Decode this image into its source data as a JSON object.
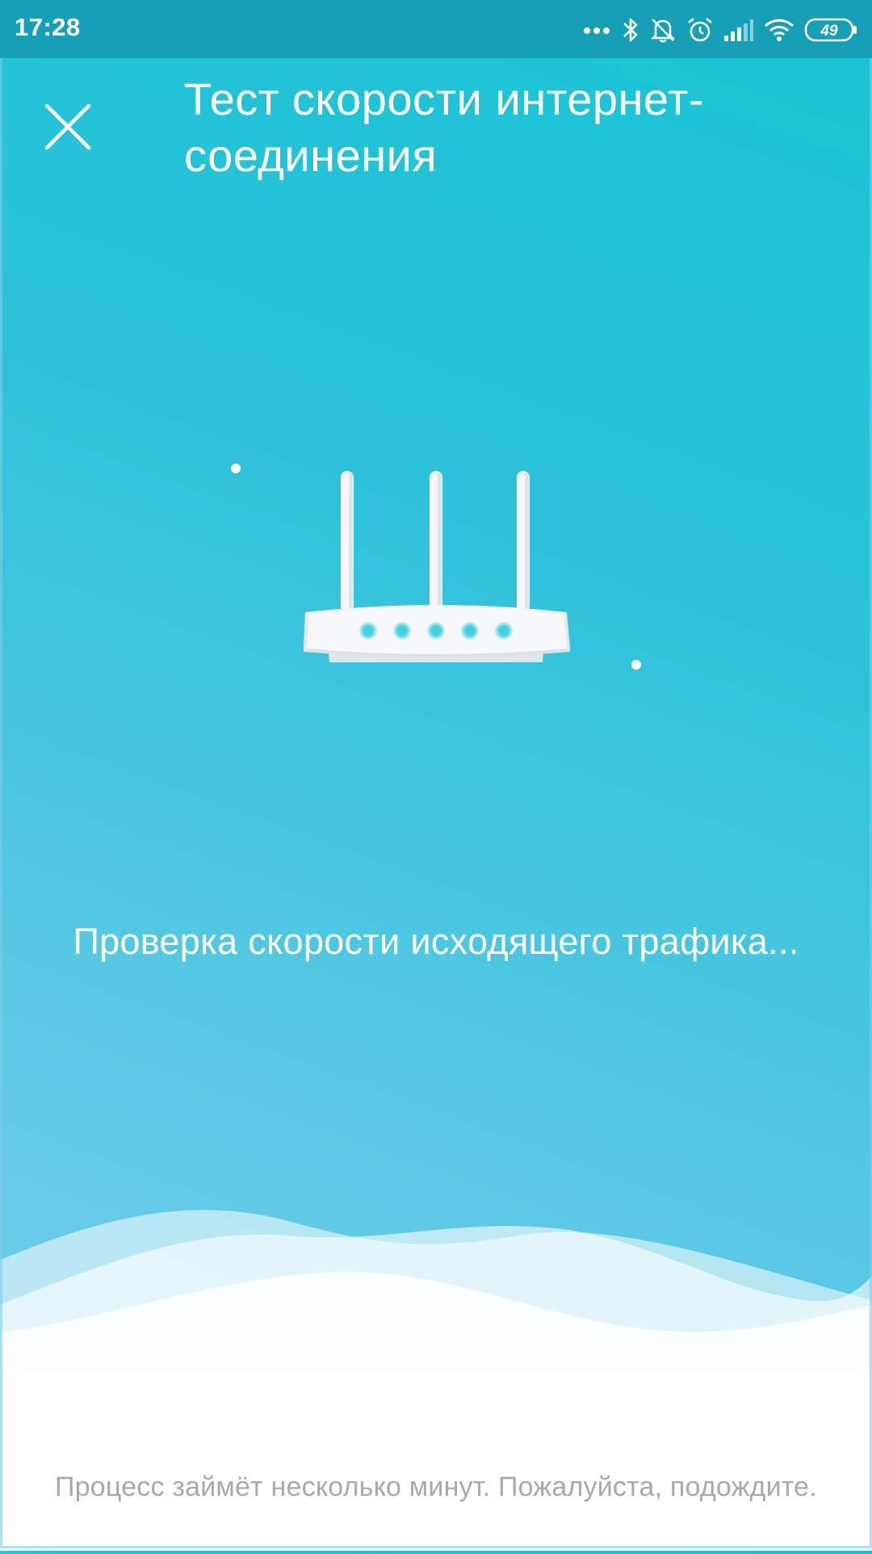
{
  "status_bar": {
    "time": "17:28",
    "battery": "49",
    "icons": [
      "more-dots-icon",
      "bluetooth-icon",
      "silent-bell-icon",
      "alarm-icon",
      "signal-icon",
      "wifi-icon",
      "battery-icon"
    ]
  },
  "header": {
    "title": "Тест скорости интернет-соединения"
  },
  "main": {
    "illustration": "router-icon",
    "status_message": "Проверка скорости исходящего трафика..."
  },
  "footer": {
    "note": "Процесс займёт несколько минут. Пожалуйста, подождите."
  },
  "colors": {
    "status_bar": "#169fb6",
    "background_top": "#17c4d3",
    "background_bottom": "#7acbeb",
    "footer_text": "#a9a9a9",
    "router_led": "#3fd0e0"
  }
}
